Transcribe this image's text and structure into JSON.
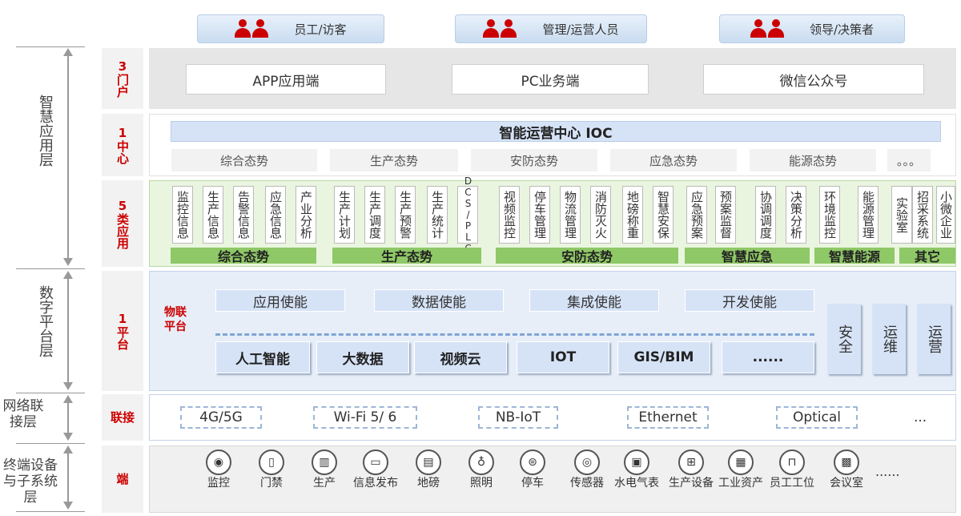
{
  "users": [
    {
      "label": "员工/访客"
    },
    {
      "label": "管理/运营人员"
    },
    {
      "label": "领导/决策者"
    }
  ],
  "left_axis": {
    "layer1": "智慧应用层",
    "layer2": "数字平台层",
    "layer3": "网络联接层",
    "layer4": "终端设备与子系统层"
  },
  "rows": {
    "portal": "3门户",
    "center": "1中心",
    "apps": "5类应用",
    "platform": "1平台",
    "connect": "联接",
    "terminal": "端"
  },
  "portal": {
    "items": [
      "APP应用端",
      "PC业务端",
      "微信公众号"
    ]
  },
  "center": {
    "title": "智能运营中心 IOC",
    "items": [
      "综合态势",
      "生产态势",
      "安防态势",
      "应急态势",
      "能源态势",
      "。。。"
    ]
  },
  "apps": {
    "items": [
      "监控信息",
      "生产信息",
      "告警信息",
      "应急信息",
      "产业分析",
      "生产计划",
      "生产调度",
      "生产预警",
      "生产统计",
      "DCS/PLC",
      "视频监控",
      "停车管理",
      "物流管理",
      "消防灭火",
      "地磅称重",
      "智慧安保",
      "应急预案",
      "预案监督",
      "协调调度",
      "决策分析",
      "环境监控",
      "能源管理",
      "实验室",
      "招采系统",
      "小微企业"
    ],
    "categories": [
      "综合态势",
      "生产态势",
      "安防态势",
      "智慧应急",
      "智慧能源",
      "其它"
    ]
  },
  "platform": {
    "iot_label": "物联平台",
    "enables": [
      "应用使能",
      "数据使能",
      "集成使能",
      "开发使能"
    ],
    "techs": [
      "人工智能",
      "大数据",
      "视频云",
      "IOT",
      "GIS/BIM",
      "......"
    ],
    "side": [
      "安全",
      "运维",
      "运营"
    ]
  },
  "network": {
    "items": [
      "4G/5G",
      "Wi-Fi 5/ 6",
      "NB-IoT",
      "Ethernet",
      "Optical",
      "..."
    ]
  },
  "terminal": {
    "items": [
      {
        "label": "监控",
        "icon": "camera-icon"
      },
      {
        "label": "门禁",
        "icon": "door-icon"
      },
      {
        "label": "生产",
        "icon": "factory-icon"
      },
      {
        "label": "信息发布",
        "icon": "phone-icon"
      },
      {
        "label": "地磅",
        "icon": "scale-icon"
      },
      {
        "label": "照明",
        "icon": "bulb-icon"
      },
      {
        "label": "停车",
        "icon": "car-icon"
      },
      {
        "label": "传感器",
        "icon": "sensor-icon"
      },
      {
        "label": "水电气表",
        "icon": "meter-icon"
      },
      {
        "label": "生产设备",
        "icon": "equipment-icon"
      },
      {
        "label": "工业资产",
        "icon": "asset-icon"
      },
      {
        "label": "员工工位",
        "icon": "workstation-icon"
      },
      {
        "label": "会议室",
        "icon": "meeting-icon"
      }
    ],
    "more": "......"
  },
  "colors": {
    "accent_red": "#cc0000",
    "app_green": "#8fc866",
    "platform_blue": "#d6e3f7"
  }
}
